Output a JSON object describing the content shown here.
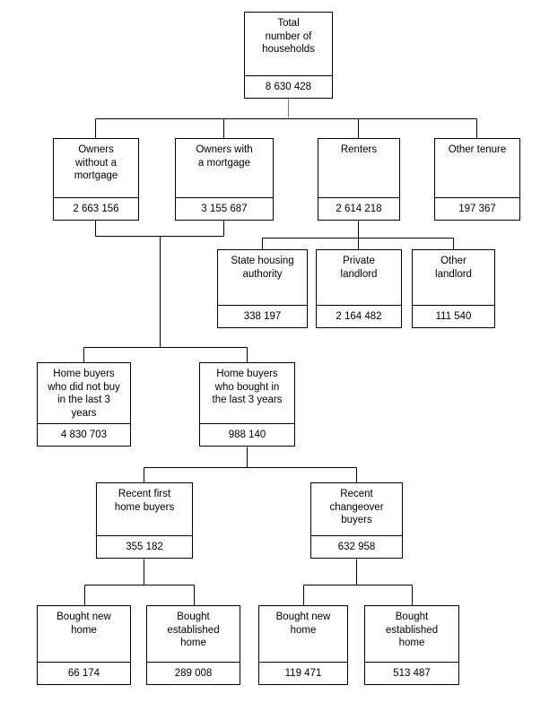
{
  "diagram": {
    "type": "hierarchy-flowchart",
    "title": "Total number of households",
    "stroke_color": "#000000",
    "accent_connector_color": "#5b7fa6",
    "background_color": "#ffffff",
    "nodes": [
      {
        "id": "total",
        "label": "Total\nnumber of\nhouseholds",
        "value": "8 630 428"
      },
      {
        "id": "owners_without_mortgage",
        "label": "Owners\nwithout a\nmortgage",
        "value": "2 663 156"
      },
      {
        "id": "owners_with_mortgage",
        "label": "Owners with\na mortgage",
        "value": "3 155 687"
      },
      {
        "id": "renters",
        "label": "Renters",
        "value": "2 614 218"
      },
      {
        "id": "other_tenure",
        "label": "Other tenure",
        "value": "197 367"
      },
      {
        "id": "state_housing_authority",
        "label": "State housing\nauthority",
        "value": "338 197"
      },
      {
        "id": "private_landlord",
        "label": "Private\nlandlord",
        "value": "2 164 482"
      },
      {
        "id": "other_landlord",
        "label": "Other\nlandlord",
        "value": "111 540"
      },
      {
        "id": "not_bought_last_3_years",
        "label": "Home buyers\nwho did not buy\nin the last 3\nyears",
        "value": "4 830 703"
      },
      {
        "id": "bought_last_3_years",
        "label": "Home buyers\nwho bought in\nthe last 3 years",
        "value": "988 140"
      },
      {
        "id": "recent_first_home_buyers",
        "label": "Recent first\nhome buyers",
        "value": "355 182"
      },
      {
        "id": "recent_changeover_buyers",
        "label": "Recent\nchangeover\nbuyers",
        "value": "632 958"
      },
      {
        "id": "first_bought_new_home",
        "label": "Bought new\nhome",
        "value": "66 174"
      },
      {
        "id": "first_bought_established_home",
        "label": "Bought\nestablished\nhome",
        "value": "289 008"
      },
      {
        "id": "changeover_bought_new_home",
        "label": "Bought new\nhome",
        "value": "119 471"
      },
      {
        "id": "changeover_bought_established_home",
        "label": "Bought\nestablished\nhome",
        "value": "513 487"
      }
    ]
  }
}
